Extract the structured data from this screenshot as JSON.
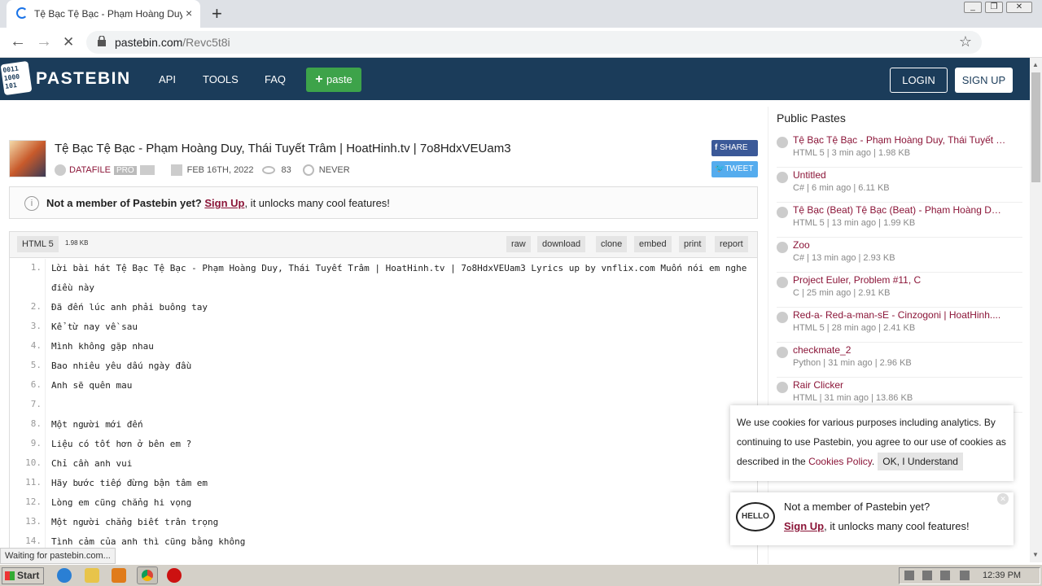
{
  "browser": {
    "tab_title": "Tệ Bạc Tệ Bạc - Phạm Hoàng Duy, Th",
    "tab_close": "×",
    "new_tab": "+",
    "url_domain": "pastebin.com",
    "url_path": "/Revc5t8i",
    "status": "Waiting for pastebin.com..."
  },
  "header": {
    "logo_text": "0011\n1000\n101",
    "brand": "PASTEBIN",
    "nav": [
      "API",
      "TOOLS",
      "FAQ"
    ],
    "paste_button": "paste",
    "login": "LOGIN",
    "signup": "SIGN UP"
  },
  "paste": {
    "title": "Tệ Bạc Tệ Bạc - Phạm Hoàng Duy, Thái Tuyết Trâm | HoatHinh.tv | 7o8HdxVEUam3",
    "user": "DATAFILE",
    "pro": "PRO",
    "date": "FEB 16TH, 2022",
    "views": "83",
    "expiry": "NEVER",
    "share": "SHARE",
    "tweet": "TWEET"
  },
  "notice": {
    "bold": "Not a member of Pastebin yet?",
    "link": "Sign Up",
    "rest": ", it unlocks many cool features!"
  },
  "code": {
    "language": "HTML 5",
    "size": "1.98 KB",
    "buttons": [
      "raw",
      "download",
      "clone",
      "embed",
      "print",
      "report"
    ],
    "lines": [
      {
        "n": "1.",
        "text": "Lời bài hát Tệ Bạc  Tệ Bạc - Phạm Hoàng Duy, Thái Tuyết Trâm  | HoatHinh.tv | 7o8HdxVEUam3 Lyrics up by vnflix.com Muốn nói em nghe điều này"
      },
      {
        "n": "2.",
        "text": "Đã đến lúc anh phải buông tay"
      },
      {
        "n": "3.",
        "text": "Kể từ nay về sau"
      },
      {
        "n": "4.",
        "text": "Mình không gặp nhau"
      },
      {
        "n": "5.",
        "text": "Bao nhiêu yêu dấu ngày đầu"
      },
      {
        "n": "6.",
        "text": "Anh sẽ quên mau"
      },
      {
        "n": "7.",
        "text": ""
      },
      {
        "n": "8.",
        "text": "Một người mới đến"
      },
      {
        "n": "9.",
        "text": "Liệu có tốt hơn ở bên em ?"
      },
      {
        "n": "10.",
        "text": "Chỉ cần anh vui"
      },
      {
        "n": "11.",
        "text": "Hãy bước tiếp đừng bận tâm em"
      },
      {
        "n": "12.",
        "text": "Lòng em cũng chẳng hi vọng"
      },
      {
        "n": "13.",
        "text": "Một người chẳng biết trân trọng"
      },
      {
        "n": "14.",
        "text": "Tình cảm của anh thì cũng bằng không"
      }
    ]
  },
  "sidebar": {
    "heading": "Public Pastes",
    "items": [
      {
        "title": "Tệ Bạc Tệ Bạc - Phạm Hoàng Duy, Thái Tuyết T...",
        "meta": "HTML 5 | 3 min ago | 1.98 KB"
      },
      {
        "title": "Untitled",
        "meta": "C# | 6 min ago | 6.11 KB"
      },
      {
        "title": "Tệ Bạc (Beat) Tệ Bạc (Beat) - Phạm Hoàng Duy...",
        "meta": "HTML 5 | 13 min ago | 1.99 KB"
      },
      {
        "title": "Zoo",
        "meta": "C# | 13 min ago | 2.93 KB"
      },
      {
        "title": "Project Euler, Problem #11, C",
        "meta": "C | 25 min ago | 2.91 KB"
      },
      {
        "title": "Red-a- Red-a-man-sE - Cinzogoni | HoatHinh....",
        "meta": "HTML 5 | 28 min ago | 2.41 KB"
      },
      {
        "title": "checkmate_2",
        "meta": "Python | 31 min ago | 2.96 KB"
      },
      {
        "title": "Rair Clicker",
        "meta": "HTML | 31 min ago | 13.86 KB"
      }
    ]
  },
  "cookie": {
    "text": "We use cookies for various purposes including analytics. By continuing to use Pastebin, you agree to our use of cookies as described in the",
    "link": "Cookies Policy",
    "ok": "OK, I Understand"
  },
  "member_popup": {
    "hello": "HELLO",
    "line1": "Not a member of Pastebin yet?",
    "link": "Sign Up",
    "rest": ", it unlocks many cool features!"
  },
  "taskbar": {
    "start": "Start",
    "clock": "12:39 PM"
  },
  "colors": {
    "header_bg": "#1b3c5a",
    "link": "#8b1538",
    "paste_green": "#3da34a"
  }
}
